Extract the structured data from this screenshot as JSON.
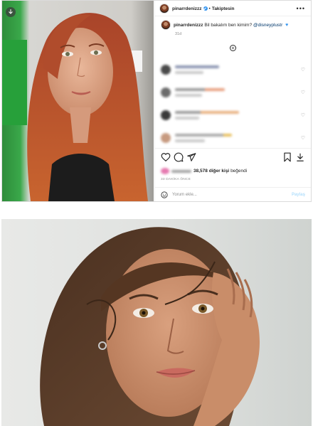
{
  "post": {
    "username": "pinarrdenizzz",
    "separator": "•",
    "follow_label": "Takiptesin",
    "more_label": "•••",
    "caption_text": "Bil bakalım ben kimim?",
    "caption_mention": "@disneyplustr",
    "caption_emoji": "♥",
    "caption_time": "31d",
    "load_more_label": "+",
    "likes_count": "38,578",
    "likes_suffix": "diğer kişi",
    "likes_end": "beğendi",
    "time_ago": "33 DAKİKA ÖNCE",
    "add_comment_placeholder": "Yorum ekle...",
    "share_label": "Paylaş"
  },
  "icons": {
    "download": "download-icon",
    "heart": "heart-icon",
    "comment": "comment-icon",
    "send": "send-icon",
    "bookmark": "bookmark-icon",
    "emoji": "emoji-icon"
  }
}
